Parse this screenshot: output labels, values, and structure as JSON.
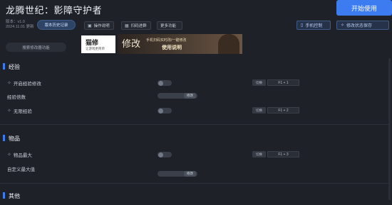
{
  "app": {
    "title": "龙腾世纪：影障守护者",
    "version_line1": "版本：v1.0",
    "version_line2": "2024.11.01 更新",
    "history_button": "版本历史记录",
    "start_button": "开始使用"
  },
  "toolbar": {
    "instructions_label": "操作说明",
    "scan_label": "扫码进群",
    "more_label": "更多功能",
    "phone_control_label": "手机控制",
    "save_state_label": "修改状态保存"
  },
  "search": {
    "label": "搜索修改器功能"
  },
  "ads": {
    "brand": "猫修",
    "brand_sub": "让游戏更简单",
    "calligraphy": "修改",
    "promo_line1": "手机扫码实时改/一键修改",
    "promo_line2": "使用说明"
  },
  "sections": [
    {
      "title": "经验",
      "rows": [
        {
          "label": "开启经验修改",
          "type": "toggle",
          "icon": "sparkle-icon",
          "tag": "切换",
          "key": "F1 + 1"
        },
        {
          "label": "经验倍数",
          "type": "slider",
          "icon": "",
          "button": "修改"
        },
        {
          "label": "无限经验",
          "type": "toggle",
          "icon": "sparkle-icon",
          "tag": "切换",
          "key": "F1 + 2"
        }
      ]
    },
    {
      "title": "物品",
      "rows": [
        {
          "label": "物品最大",
          "type": "toggle",
          "icon": "sparkle-icon",
          "tag": "切换",
          "key": "F1 + 3"
        },
        {
          "label": "自定义最大值",
          "type": "slider",
          "icon": "",
          "button": "修改"
        }
      ]
    },
    {
      "title": "其他",
      "rows": []
    }
  ],
  "colors": {
    "accent": "#3d7cf0",
    "background": "#1e2128"
  }
}
